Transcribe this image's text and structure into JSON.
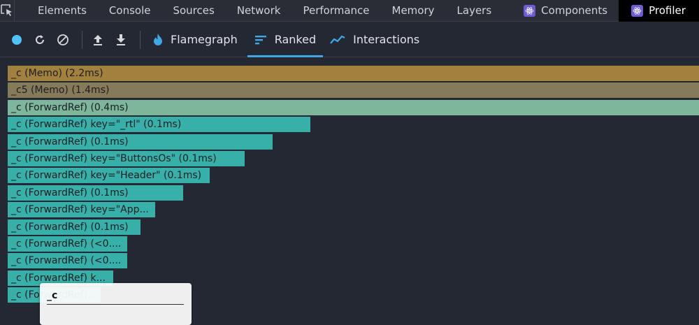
{
  "tabs": [
    {
      "label": "Elements",
      "active": false
    },
    {
      "label": "Console",
      "active": false
    },
    {
      "label": "Sources",
      "active": false
    },
    {
      "label": "Network",
      "active": false
    },
    {
      "label": "Performance",
      "active": false
    },
    {
      "label": "Memory",
      "active": false
    },
    {
      "label": "Layers",
      "active": false
    },
    {
      "label": "Components",
      "active": false,
      "icon": "react-icon"
    },
    {
      "label": "Profiler",
      "active": true,
      "icon": "react-icon"
    }
  ],
  "toolbar": {
    "views": [
      {
        "label": "Flamegraph",
        "icon": "flame-icon",
        "active": false
      },
      {
        "label": "Ranked",
        "icon": "ranked-icon",
        "active": true
      },
      {
        "label": "Interactions",
        "icon": "interactions-icon",
        "active": false
      }
    ]
  },
  "colors": {
    "bar_memo_1": "#a2813f",
    "bar_memo_2": "#857b5a",
    "bar_forward_light": "#7db69a",
    "bar_teal": "#36b0a8",
    "active_tab_underline": "#3ea8e5",
    "record_button": "#4fc3f7"
  },
  "ranked": [
    {
      "label": "_c (Memo) (2.2ms)",
      "fill": 1.0,
      "color": "bar_memo_1"
    },
    {
      "label": "_c5 (Memo) (1.4ms)",
      "fill": 1.0,
      "color": "bar_memo_2"
    },
    {
      "label": "_c (ForwardRef) (0.4ms)",
      "fill": 1.0,
      "color": "bar_forward_light"
    },
    {
      "label": "_c (ForwardRef) key=\"_rtl\" (0.1ms)",
      "fill": 0.4379,
      "color": "bar_teal"
    },
    {
      "label": "_c (ForwardRef) (0.1ms)",
      "fill": 0.3836,
      "color": "bar_teal"
    },
    {
      "label": "_c (ForwardRef) key=\"ButtonsOs\" (0.1ms)",
      "fill": 0.3432,
      "color": "bar_teal"
    },
    {
      "label": "_c (ForwardRef) key=\"Header\" (0.1ms)",
      "fill": 0.2927,
      "color": "bar_teal"
    },
    {
      "label": "_c (ForwardRef) (0.1ms)",
      "fill": 0.2533,
      "color": "bar_teal"
    },
    {
      "label": "_c (ForwardRef) key=\"App...",
      "fill": 0.2129,
      "color": "bar_teal"
    },
    {
      "label": "_c (ForwardRef) (0.1ms)",
      "fill": 0.1918,
      "color": "bar_teal"
    },
    {
      "label": "_c (ForwardRef) (<0....",
      "fill": 0.1726,
      "color": "bar_teal"
    },
    {
      "label": "_c (ForwardRef) (<0....",
      "fill": 0.1726,
      "color": "bar_teal"
    },
    {
      "label": "_c (ForwardRef) k...",
      "fill": 0.1524,
      "color": "bar_teal"
    },
    {
      "label": "_c (ForwardRef)...",
      "fill": 0.1342,
      "color": "bar_teal"
    }
  ],
  "tooltip": {
    "title": "_c"
  }
}
